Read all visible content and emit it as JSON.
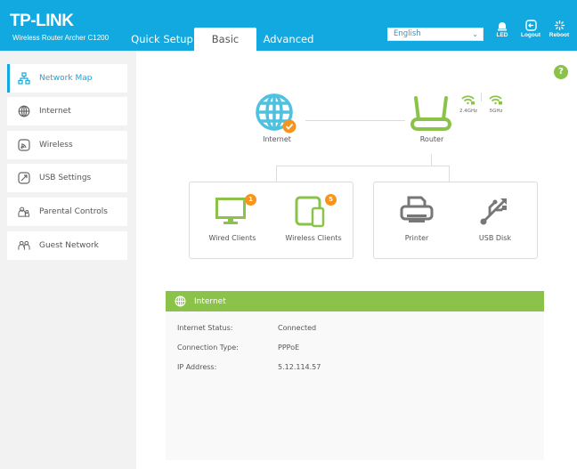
{
  "header": {
    "brand": "TP-LINK",
    "model": "Wireless Router Archer C1200",
    "tabs": [
      {
        "label": "Quick Setup",
        "active": false
      },
      {
        "label": "Basic",
        "active": true
      },
      {
        "label": "Advanced",
        "active": false
      }
    ],
    "language": {
      "selected": "English"
    },
    "buttons": [
      {
        "label": "LED",
        "icon": "led-icon"
      },
      {
        "label": "Logout",
        "icon": "logout-icon"
      },
      {
        "label": "Reboot",
        "icon": "reboot-icon"
      }
    ],
    "colors": {
      "header_bg": "#11a9df",
      "accent_green": "#8bc34a",
      "badge_orange": "#f7941d"
    }
  },
  "sidebar": {
    "items": [
      {
        "label": "Network Map",
        "icon": "network-map-icon",
        "active": true
      },
      {
        "label": "Internet",
        "icon": "globe-icon",
        "active": false
      },
      {
        "label": "Wireless",
        "icon": "wireless-icon",
        "active": false
      },
      {
        "label": "USB Settings",
        "icon": "usb-icon",
        "active": false
      },
      {
        "label": "Parental Controls",
        "icon": "parental-controls-icon",
        "active": false
      },
      {
        "label": "Guest Network",
        "icon": "guest-network-icon",
        "active": false
      }
    ]
  },
  "map": {
    "internet_label": "Internet",
    "router_label": "Router",
    "bands": [
      "2.4GHz",
      "5GHz"
    ],
    "clients": [
      {
        "label": "Wired Clients",
        "count": "1"
      },
      {
        "label": "Wireless Clients",
        "count": "5"
      }
    ],
    "usb_devices": [
      {
        "label": "Printer"
      },
      {
        "label": "USB Disk"
      }
    ],
    "help": "?"
  },
  "panel": {
    "title": "Internet",
    "rows": [
      {
        "key": "Internet Status:",
        "value": "Connected"
      },
      {
        "key": "Connection Type:",
        "value": "PPPoE"
      },
      {
        "key": "IP Address:",
        "value": "5.12.114.57"
      }
    ]
  }
}
